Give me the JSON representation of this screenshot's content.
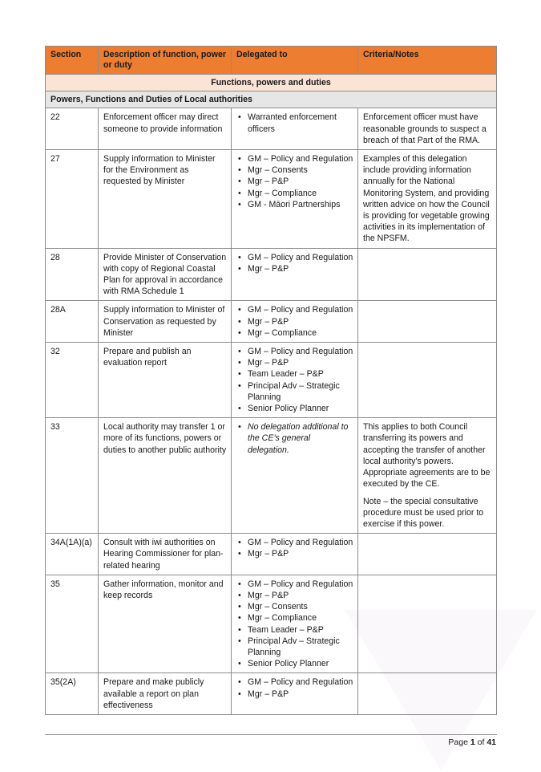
{
  "table": {
    "headers": [
      "Section",
      "Description of function, power or duty",
      "Delegated to",
      "Criteria/Notes"
    ],
    "band_title": "Functions, powers and duties",
    "group_title": "Powers, Functions and Duties of Local authorities",
    "rows": [
      {
        "section": "22",
        "description": "Enforcement officer may direct someone to provide information",
        "delegated_to": [
          "Warranted enforcement officers"
        ],
        "notes": [
          "Enforcement officer must have reasonable grounds to suspect a breach of that Part of the RMA."
        ]
      },
      {
        "section": "27",
        "description": "Supply information to Minister for the Environment as requested by Minister",
        "delegated_to": [
          "GM – Policy and Regulation",
          "Mgr – Consents",
          "Mgr – P&P",
          "Mgr – Compliance",
          "GM - Māori Partnerships"
        ],
        "notes": [
          "Examples of this delegation include providing information annually for the National Monitoring System, and providing written advice on how the Council is providing for vegetable growing activities in its implementation of the NPSFM."
        ]
      },
      {
        "section": "28",
        "description": "Provide Minister of Conservation with copy of Regional Coastal Plan for approval in accordance with RMA Schedule 1",
        "delegated_to": [
          "GM – Policy and Regulation",
          "Mgr – P&P"
        ],
        "notes": []
      },
      {
        "section": "28A",
        "description": "Supply information to Minister of Conservation as requested by Minister",
        "delegated_to": [
          "GM – Policy and Regulation",
          "Mgr – P&P",
          "Mgr – Compliance"
        ],
        "notes": []
      },
      {
        "section": "32",
        "description": "Prepare and publish an evaluation report",
        "delegated_to": [
          "GM – Policy and Regulation",
          "Mgr – P&P",
          "Team Leader – P&P",
          "Principal Adv – Strategic Planning",
          "Senior Policy Planner"
        ],
        "notes": []
      },
      {
        "section": "33",
        "description": "Local authority may transfer 1 or more of its functions, powers or duties to another public authority",
        "delegated_to_italic": "No delegation additional to the CE’s general delegation.",
        "notes": [
          "This applies to both Council transferring its powers and accepting the transfer of another local authority’s powers. Appropriate agreements are to be executed by the CE.",
          "Note – the special consultative procedure must be used prior to exercise if this power."
        ]
      },
      {
        "section": "34A(1A)(a)",
        "description": "Consult with iwi authorities on Hearing Commissioner for plan-related hearing",
        "delegated_to": [
          "GM – Policy and Regulation",
          "Mgr – P&P"
        ],
        "notes": []
      },
      {
        "section": "35",
        "description": "Gather information, monitor and keep records",
        "delegated_to": [
          "GM – Policy and Regulation",
          "Mgr – P&P",
          "Mgr – Consents",
          "Mgr – Compliance",
          "Team Leader – P&P",
          "Principal Adv – Strategic Planning",
          "Senior Policy Planner"
        ],
        "notes": []
      },
      {
        "section": "35(2A)",
        "description": "Prepare and make publicly available a report on plan effectiveness",
        "delegated_to": [
          "GM – Policy and Regulation",
          "Mgr – P&P"
        ],
        "notes": []
      }
    ]
  },
  "footer": {
    "page_label": "Page",
    "page_current": "1",
    "of_label": "of",
    "page_total": "41"
  },
  "colors": {
    "header_bg": "#ed7d31",
    "band_bg": "#fbe4d5",
    "group_bg": "#e7e6e6",
    "border": "#8c8c8c"
  }
}
